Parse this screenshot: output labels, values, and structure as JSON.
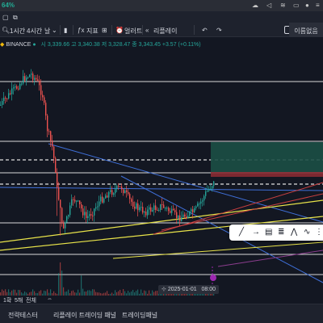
{
  "macbar": {
    "percent": "64%",
    "icons": [
      "cloud-icon",
      "speaker-icon",
      "wifi-icon",
      "battery-icon",
      "user-icon",
      "menu-icon"
    ]
  },
  "toolbar": {
    "tf_1h": "1시간",
    "tf_4h": "4시간",
    "more": "날",
    "indicators": "지표",
    "alert": "얼러트",
    "replay": "리플레이",
    "right_button": "이름없음"
  },
  "legend": {
    "symbol": "BINANCE",
    "open": "시 3,339.66",
    "high": "고 3,340.38",
    "low": "저 3,328.47",
    "close": "종 3,343.45",
    "change": "+3.57 (+0.11%)"
  },
  "crosshair_date": "2025-01-01",
  "crosshair_time": "08:00",
  "range": {
    "r1": "1확",
    "r2": "5해",
    "r3": "전체"
  },
  "bottom_tabs": {
    "t1": "전략테스터",
    "t2": "리플레이 트레이딩 패널",
    "t3": "트레이딩패널"
  },
  "colors": {
    "up": "#26a69a",
    "down": "#ef5350",
    "bg": "#131722",
    "panel": "#1e222d"
  }
}
